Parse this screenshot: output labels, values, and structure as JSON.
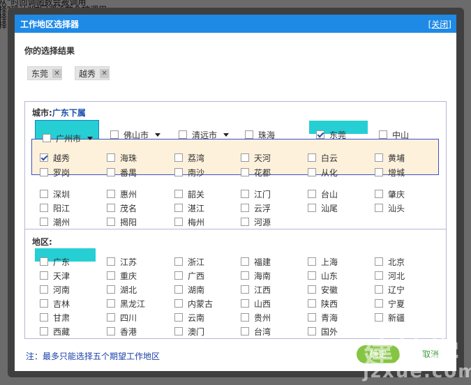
{
  "background_text": [
    "从\"时回调函数会被调用",
    "择\"确认\"时回调函数会被调用",
    "择",
    "择"
  ],
  "dialog": {
    "title": "工作地区选择器",
    "close_label": "[关闭]",
    "selection_title": "你的选择结果",
    "selected_tags": [
      "东莞",
      "越秀"
    ],
    "city_section": {
      "label_prefix": "城市:",
      "label_highlight": "广东下属"
    },
    "city_tabs": [
      {
        "label": "广州市",
        "dropdown": true,
        "checked": false,
        "active": true
      },
      {
        "label": "佛山市",
        "dropdown": true,
        "checked": false
      },
      {
        "label": "清远市",
        "dropdown": true,
        "checked": false
      },
      {
        "label": "珠海",
        "dropdown": false,
        "checked": false
      },
      {
        "label": "东莞",
        "dropdown": false,
        "checked": true,
        "highlight": true
      },
      {
        "label": "中山",
        "dropdown": false,
        "checked": false
      }
    ],
    "districts": [
      {
        "label": "越秀",
        "checked": true
      },
      {
        "label": "海珠",
        "checked": false
      },
      {
        "label": "荔湾",
        "checked": false
      },
      {
        "label": "天河",
        "checked": false
      },
      {
        "label": "白云",
        "checked": false
      },
      {
        "label": "黄埔",
        "checked": false
      },
      {
        "label": "罗岗",
        "checked": false
      },
      {
        "label": "番禺",
        "checked": false
      },
      {
        "label": "南沙",
        "checked": false
      },
      {
        "label": "花都",
        "checked": false
      },
      {
        "label": "从化",
        "checked": false
      },
      {
        "label": "增城",
        "checked": false
      }
    ],
    "other_cities": [
      "深圳",
      "惠州",
      "韶关",
      "江门",
      "台山",
      "肇庆",
      "阳江",
      "茂名",
      "湛江",
      "云浮",
      "汕尾",
      "汕头",
      "潮州",
      "揭阳",
      "梅州",
      "河源"
    ],
    "region_section": {
      "label": "地区:"
    },
    "regions": [
      "广东",
      "江苏",
      "浙江",
      "福建",
      "上海",
      "北京",
      "天津",
      "重庆",
      "广西",
      "海南",
      "山东",
      "河北",
      "河南",
      "湖北",
      "湖南",
      "江西",
      "安徽",
      "辽宁",
      "吉林",
      "黑龙江",
      "内蒙古",
      "山西",
      "陕西",
      "宁夏",
      "甘肃",
      "四川",
      "云南",
      "贵州",
      "青海",
      "新疆",
      "西藏",
      "香港",
      "澳门",
      "台湾",
      "国外"
    ],
    "region_highlight": "广东",
    "note": "注：最多只能选择五个期望工作地区",
    "ok_label": "确定",
    "cancel_label": "取消"
  },
  "watermark": {
    "main": "建站学",
    "sub": "jzxue.com"
  },
  "colors": {
    "title_bar": "#1f8ae6",
    "highlight": "#25cfd3",
    "sub_panel": "#fdf1dc",
    "ok_button": "#86c443"
  }
}
